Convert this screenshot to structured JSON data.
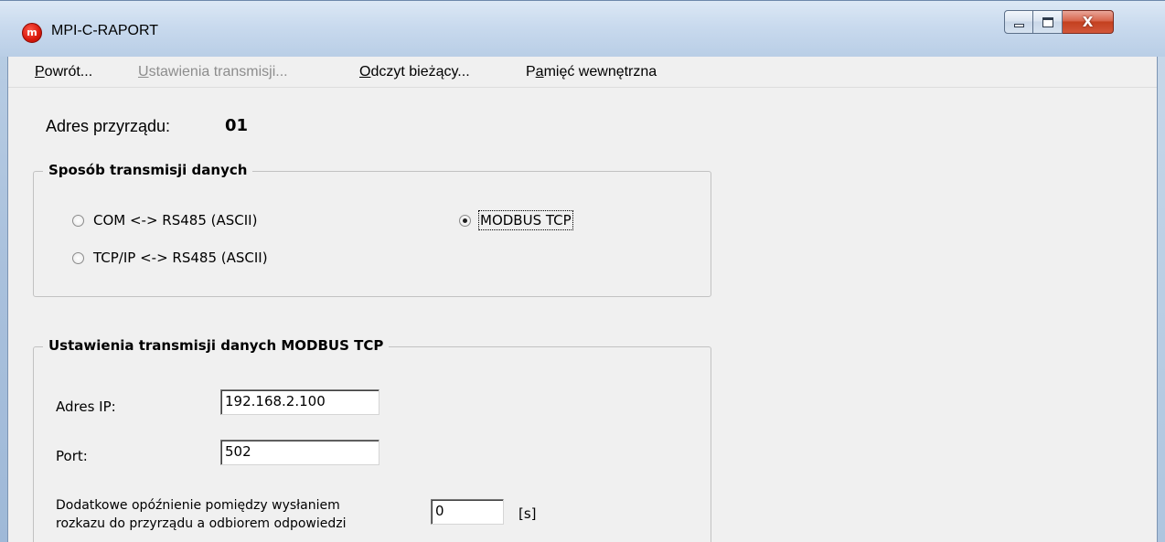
{
  "window": {
    "title": "MPI-C-RAPORT",
    "app_icon_letter": "m",
    "close_glyph": "X"
  },
  "menu": {
    "items": [
      {
        "label_u": "P",
        "label_rest": "owrót...",
        "enabled": true
      },
      {
        "label_u": "U",
        "label_rest": "stawienia transmisji...",
        "enabled": false
      },
      {
        "label_u": "O",
        "label_rest": "dczyt bieżący...",
        "enabled": true
      },
      {
        "label_pre": "P",
        "label_u": "a",
        "label_rest": "mięć wewnętrzna",
        "enabled": true
      }
    ]
  },
  "device": {
    "label": "Adres przyrządu:",
    "value": "01"
  },
  "transmission_mode": {
    "title": "Sposób transmisji danych",
    "options": [
      {
        "label": "COM <-> RS485 (ASCII)",
        "checked": false
      },
      {
        "label": "TCP/IP <-> RS485 (ASCII)",
        "checked": false
      },
      {
        "label": "MODBUS TCP",
        "checked": true
      }
    ]
  },
  "modbus_settings": {
    "title": "Ustawienia transmisji danych MODBUS TCP",
    "ip_label": "Adres IP:",
    "ip_value": "192.168.2.100",
    "port_label": "Port:",
    "port_value": "502",
    "delay_label_line1": "Dodatkowe opóźnienie pomiędzy wysłaniem",
    "delay_label_line2": "rozkazu do przyrządu a odbiorem odpowiedzi",
    "delay_value": "0",
    "delay_unit": "[s]"
  },
  "colors": {
    "dialog_bg": "#f0f0f0",
    "close_button": "#c3401f",
    "title_bar": "#c9daee"
  }
}
